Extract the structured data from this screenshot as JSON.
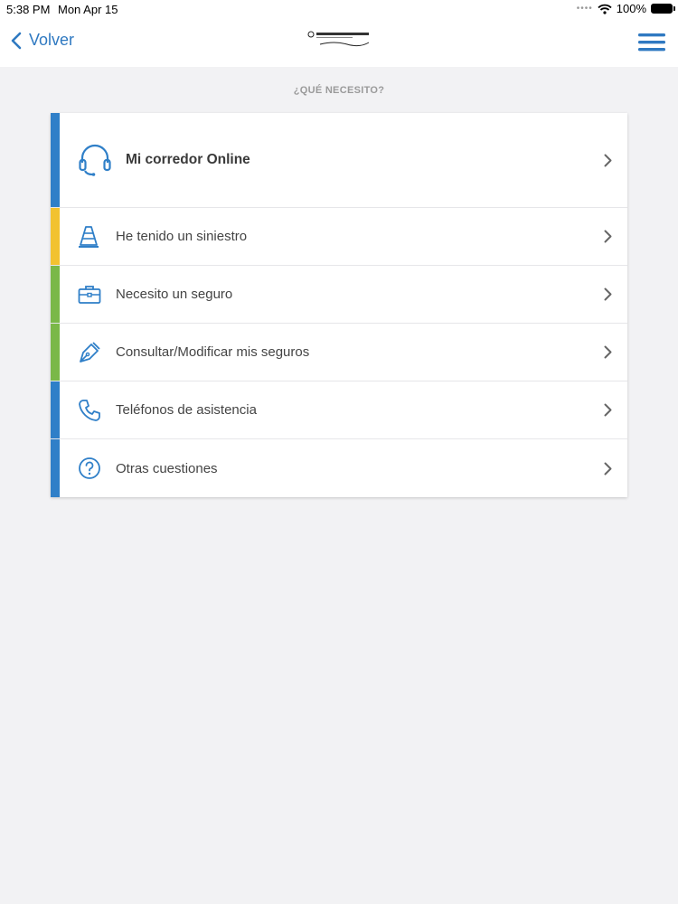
{
  "status_bar": {
    "time": "5:38 PM",
    "date": "Mon Apr 15",
    "battery": "100%"
  },
  "nav": {
    "back_label": "Volver",
    "logo_text": "DESPREOCUPATE",
    "logo_tagline": "Nos preocupamos por ti"
  },
  "section_title": "¿QUÉ NECESITO?",
  "menu": {
    "items": [
      {
        "label": "Mi corredor Online",
        "icon": "headset-icon",
        "color": "#2f7fc8"
      },
      {
        "label": "He tenido un siniestro",
        "icon": "traffic-cone-icon",
        "color": "#f2c230"
      },
      {
        "label": "Necesito un seguro",
        "icon": "briefcase-icon",
        "color": "#7ab848"
      },
      {
        "label": "Consultar/Modificar mis seguros",
        "icon": "pen-icon",
        "color": "#7ab848"
      },
      {
        "label": "Teléfonos de asistencia",
        "icon": "phone-icon",
        "color": "#2f7fc8"
      },
      {
        "label": "Otras cuestiones",
        "icon": "question-circle-icon",
        "color": "#2f7fc8"
      }
    ]
  },
  "colors": {
    "accent": "#2f79c1",
    "icon": "#2f7fc8",
    "background": "#f2f2f4"
  }
}
